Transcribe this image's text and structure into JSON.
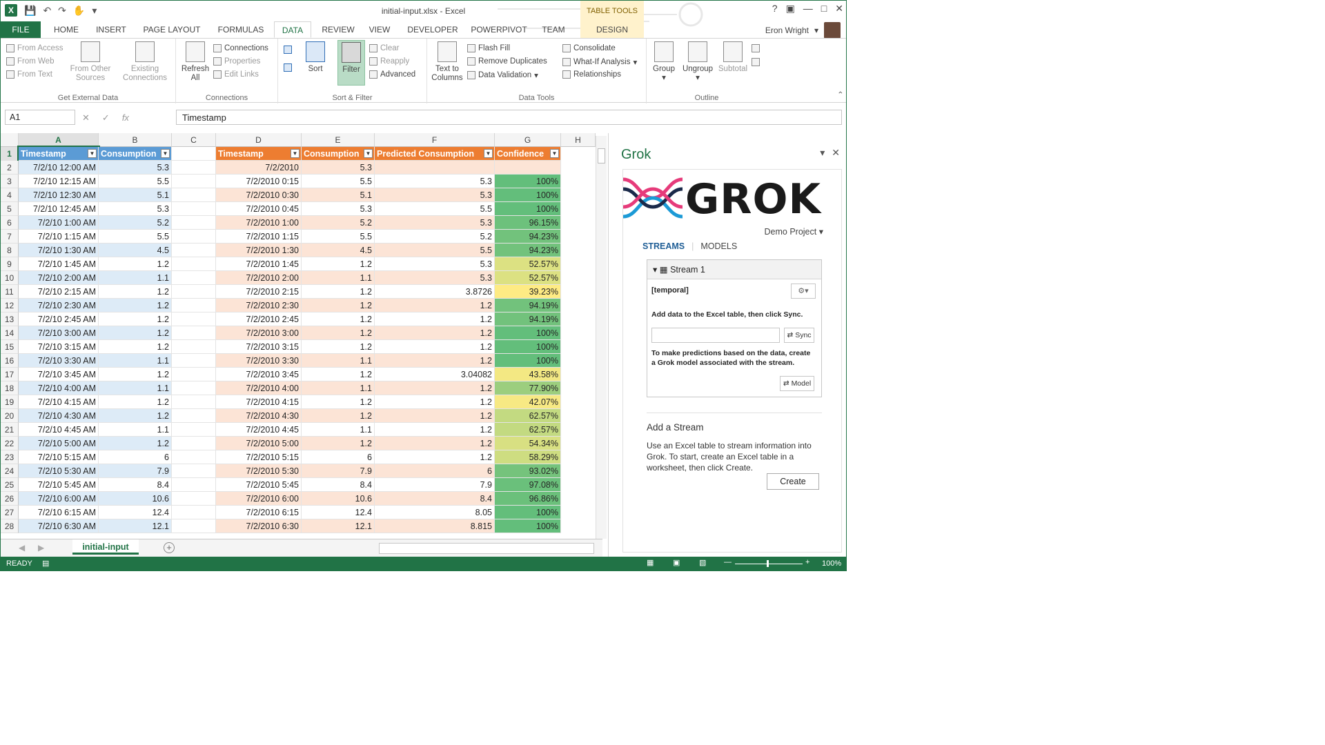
{
  "app": {
    "title": "initial-input.xlsx - Excel",
    "table_tools": "TABLE TOOLS",
    "user": "Eron Wright",
    "tabs": [
      "FILE",
      "HOME",
      "INSERT",
      "PAGE LAYOUT",
      "FORMULAS",
      "DATA",
      "REVIEW",
      "VIEW",
      "DEVELOPER",
      "POWERPIVOT",
      "TEAM",
      "DESIGN"
    ],
    "active_tab": "DATA",
    "help": "?"
  },
  "ribbon": {
    "get_external": {
      "label": "Get External Data",
      "from_access": "From Access",
      "from_web": "From Web",
      "from_text": "From Text",
      "from_other_1": "From Other",
      "from_other_2": "Sources",
      "existing_1": "Existing",
      "existing_2": "Connections"
    },
    "connections": {
      "label": "Connections",
      "refresh_1": "Refresh",
      "refresh_2": "All",
      "connections": "Connections",
      "properties": "Properties",
      "edit_links": "Edit Links"
    },
    "sort_filter": {
      "label": "Sort & Filter",
      "sort": "Sort",
      "filter": "Filter",
      "clear": "Clear",
      "reapply": "Reapply",
      "advanced": "Advanced"
    },
    "data_tools": {
      "label": "Data Tools",
      "text_to_1": "Text to",
      "text_to_2": "Columns",
      "flash_fill": "Flash Fill",
      "remove_dup": "Remove Duplicates",
      "data_validation": "Data Validation",
      "consolidate": "Consolidate",
      "what_if": "What-If Analysis",
      "relationships": "Relationships"
    },
    "outline": {
      "label": "Outline",
      "group": "Group",
      "ungroup": "Ungroup",
      "subtotal": "Subtotal"
    }
  },
  "formula": {
    "namebox": "A1",
    "value": "Timestamp"
  },
  "grid": {
    "columns": [
      "A",
      "B",
      "C",
      "D",
      "E",
      "F",
      "G",
      "H"
    ],
    "headers": {
      "a": "Timestamp",
      "b": "Consumption",
      "d": "Timestamp",
      "e": "Consumption",
      "f": "Predicted Consumption",
      "g": "Confidence"
    },
    "rows": [
      [
        "7/2/10 12:00 AM",
        "5.3",
        "7/2/2010",
        "5.3",
        "",
        ""
      ],
      [
        "7/2/10 12:15 AM",
        "5.5",
        "7/2/2010 0:15",
        "5.5",
        "5.3",
        "100%"
      ],
      [
        "7/2/10 12:30 AM",
        "5.1",
        "7/2/2010 0:30",
        "5.1",
        "5.3",
        "100%"
      ],
      [
        "7/2/10 12:45 AM",
        "5.3",
        "7/2/2010 0:45",
        "5.3",
        "5.5",
        "100%"
      ],
      [
        "7/2/10 1:00 AM",
        "5.2",
        "7/2/2010 1:00",
        "5.2",
        "5.3",
        "96.15%"
      ],
      [
        "7/2/10 1:15 AM",
        "5.5",
        "7/2/2010 1:15",
        "5.5",
        "5.2",
        "94.23%"
      ],
      [
        "7/2/10 1:30 AM",
        "4.5",
        "7/2/2010 1:30",
        "4.5",
        "5.5",
        "94.23%"
      ],
      [
        "7/2/10 1:45 AM",
        "1.2",
        "7/2/2010 1:45",
        "1.2",
        "5.3",
        "52.57%"
      ],
      [
        "7/2/10 2:00 AM",
        "1.1",
        "7/2/2010 2:00",
        "1.1",
        "5.3",
        "52.57%"
      ],
      [
        "7/2/10 2:15 AM",
        "1.2",
        "7/2/2010 2:15",
        "1.2",
        "3.8726",
        "39.23%"
      ],
      [
        "7/2/10 2:30 AM",
        "1.2",
        "7/2/2010 2:30",
        "1.2",
        "1.2",
        "94.19%"
      ],
      [
        "7/2/10 2:45 AM",
        "1.2",
        "7/2/2010 2:45",
        "1.2",
        "1.2",
        "94.19%"
      ],
      [
        "7/2/10 3:00 AM",
        "1.2",
        "7/2/2010 3:00",
        "1.2",
        "1.2",
        "100%"
      ],
      [
        "7/2/10 3:15 AM",
        "1.2",
        "7/2/2010 3:15",
        "1.2",
        "1.2",
        "100%"
      ],
      [
        "7/2/10 3:30 AM",
        "1.1",
        "7/2/2010 3:30",
        "1.1",
        "1.2",
        "100%"
      ],
      [
        "7/2/10 3:45 AM",
        "1.2",
        "7/2/2010 3:45",
        "1.2",
        "3.04082",
        "43.58%"
      ],
      [
        "7/2/10 4:00 AM",
        "1.1",
        "7/2/2010 4:00",
        "1.1",
        "1.2",
        "77.90%"
      ],
      [
        "7/2/10 4:15 AM",
        "1.2",
        "7/2/2010 4:15",
        "1.2",
        "1.2",
        "42.07%"
      ],
      [
        "7/2/10 4:30 AM",
        "1.2",
        "7/2/2010 4:30",
        "1.2",
        "1.2",
        "62.57%"
      ],
      [
        "7/2/10 4:45 AM",
        "1.1",
        "7/2/2010 4:45",
        "1.1",
        "1.2",
        "62.57%"
      ],
      [
        "7/2/10 5:00 AM",
        "1.2",
        "7/2/2010 5:00",
        "1.2",
        "1.2",
        "54.34%"
      ],
      [
        "7/2/10 5:15 AM",
        "6",
        "7/2/2010 5:15",
        "6",
        "1.2",
        "58.29%"
      ],
      [
        "7/2/10 5:30 AM",
        "7.9",
        "7/2/2010 5:30",
        "7.9",
        "6",
        "93.02%"
      ],
      [
        "7/2/10 5:45 AM",
        "8.4",
        "7/2/2010 5:45",
        "8.4",
        "7.9",
        "97.08%"
      ],
      [
        "7/2/10 6:00 AM",
        "10.6",
        "7/2/2010 6:00",
        "10.6",
        "8.4",
        "96.86%"
      ],
      [
        "7/2/10 6:15 AM",
        "12.4",
        "7/2/2010 6:15",
        "12.4",
        "8.05",
        "100%"
      ],
      [
        "7/2/10 6:30 AM",
        "12.1",
        "7/2/2010 6:30",
        "12.1",
        "8.815",
        "100%"
      ]
    ]
  },
  "sheet": {
    "tab": "initial-input"
  },
  "status": {
    "ready": "READY",
    "zoom": "100%"
  },
  "grok": {
    "title": "Grok",
    "logo": "GROK",
    "project": "Demo Project",
    "tab_streams": "STREAMS",
    "tab_models": "MODELS",
    "stream_name": "Stream 1",
    "stream_tag": "[temporal]",
    "note_add": "Add data to the Excel table, then click Sync.",
    "sync": "Sync",
    "note_predict": "To make predictions based on the data, create a Grok model associated with the stream.",
    "model": "Model",
    "add_title": "Add a Stream",
    "add_desc": "Use an Excel table to stream information into Grok. To start, create an Excel table in a worksheet, then click Create.",
    "create": "Create"
  },
  "colors": {
    "excel_green": "#217346",
    "table_blue": "#5b9bd5",
    "table_orange": "#ed7d31",
    "conf_high": "#63be7b",
    "conf_low": "#ffeb84"
  }
}
